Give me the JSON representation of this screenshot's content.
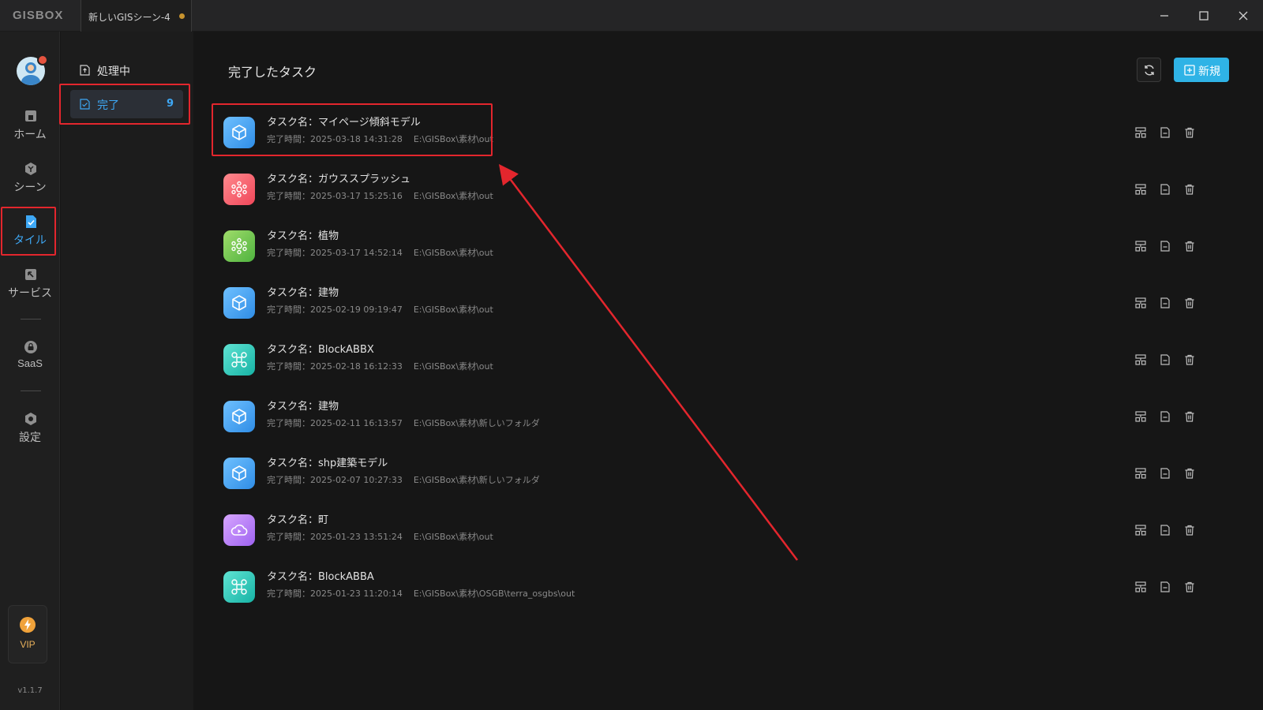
{
  "window": {
    "app_logo": "GISBOX",
    "doc_tab": "新しいGISシーン-4"
  },
  "rail": {
    "items": [
      {
        "label": "ホーム",
        "icon": "home-icon"
      },
      {
        "label": "シーン",
        "icon": "scene-icon"
      },
      {
        "label": "タイル",
        "icon": "tile-icon"
      },
      {
        "label": "サービス",
        "icon": "service-icon"
      },
      {
        "label": "SaaS",
        "icon": "lock-icon"
      },
      {
        "label": "設定",
        "icon": "gear-icon"
      }
    ],
    "vip_label": "VIP",
    "version": "v1.1.7"
  },
  "subnav": {
    "processing_label": "処理中",
    "completed_label": "完了",
    "completed_count": "9"
  },
  "main": {
    "title": "完了したタスク",
    "new_button": "新規"
  },
  "tasks": [
    {
      "name": "タスク名：マイページ傾斜モデル",
      "time": "完了時間：2025-03-18 14:31:28",
      "path": "E:\\GISBox\\素材\\out",
      "icon": "cube-icon",
      "color": "blue"
    },
    {
      "name": "タスク名：ガウススプラッシュ",
      "time": "完了時間：2025-03-17 15:25:16",
      "path": "E:\\GISBox\\素材\\out",
      "icon": "splat-icon",
      "color": "red"
    },
    {
      "name": "タスク名：植物",
      "time": "完了時間：2025-03-17 14:52:14",
      "path": "E:\\GISBox\\素材\\out",
      "icon": "splat-icon",
      "color": "green"
    },
    {
      "name": "タスク名：建物",
      "time": "完了時間：2025-02-19 09:19:47",
      "path": "E:\\GISBox\\素材\\out",
      "icon": "cube-icon",
      "color": "blue"
    },
    {
      "name": "タスク名：BlockABBX",
      "time": "完了時間：2025-02-18 16:12:33",
      "path": "E:\\GISBox\\素材\\out",
      "icon": "drone-icon",
      "color": "teal"
    },
    {
      "name": "タスク名：建物",
      "time": "完了時間：2025-02-11 16:13:57",
      "path": "E:\\GISBox\\素材\\新しいフォルダ",
      "icon": "cube-icon",
      "color": "blue"
    },
    {
      "name": "タスク名：shp建築モデル",
      "time": "完了時間：2025-02-07 10:27:33",
      "path": "E:\\GISBox\\素材\\新しいフォルダ",
      "icon": "cube-icon",
      "color": "blue"
    },
    {
      "name": "タスク名：町",
      "time": "完了時間：2025-01-23 13:51:24",
      "path": "E:\\GISBox\\素材\\out",
      "icon": "cloud-icon",
      "color": "purple"
    },
    {
      "name": "タスク名：BlockABBA",
      "time": "完了時間：2025-01-23 11:20:14",
      "path": "E:\\GISBox\\素材\\OSGB\\terra_osgbs\\out",
      "icon": "drone-icon",
      "color": "teal"
    }
  ],
  "colors": {
    "accent": "#3ea8f5",
    "new_button": "#2fb3e6",
    "annotation": "#e3262d"
  }
}
